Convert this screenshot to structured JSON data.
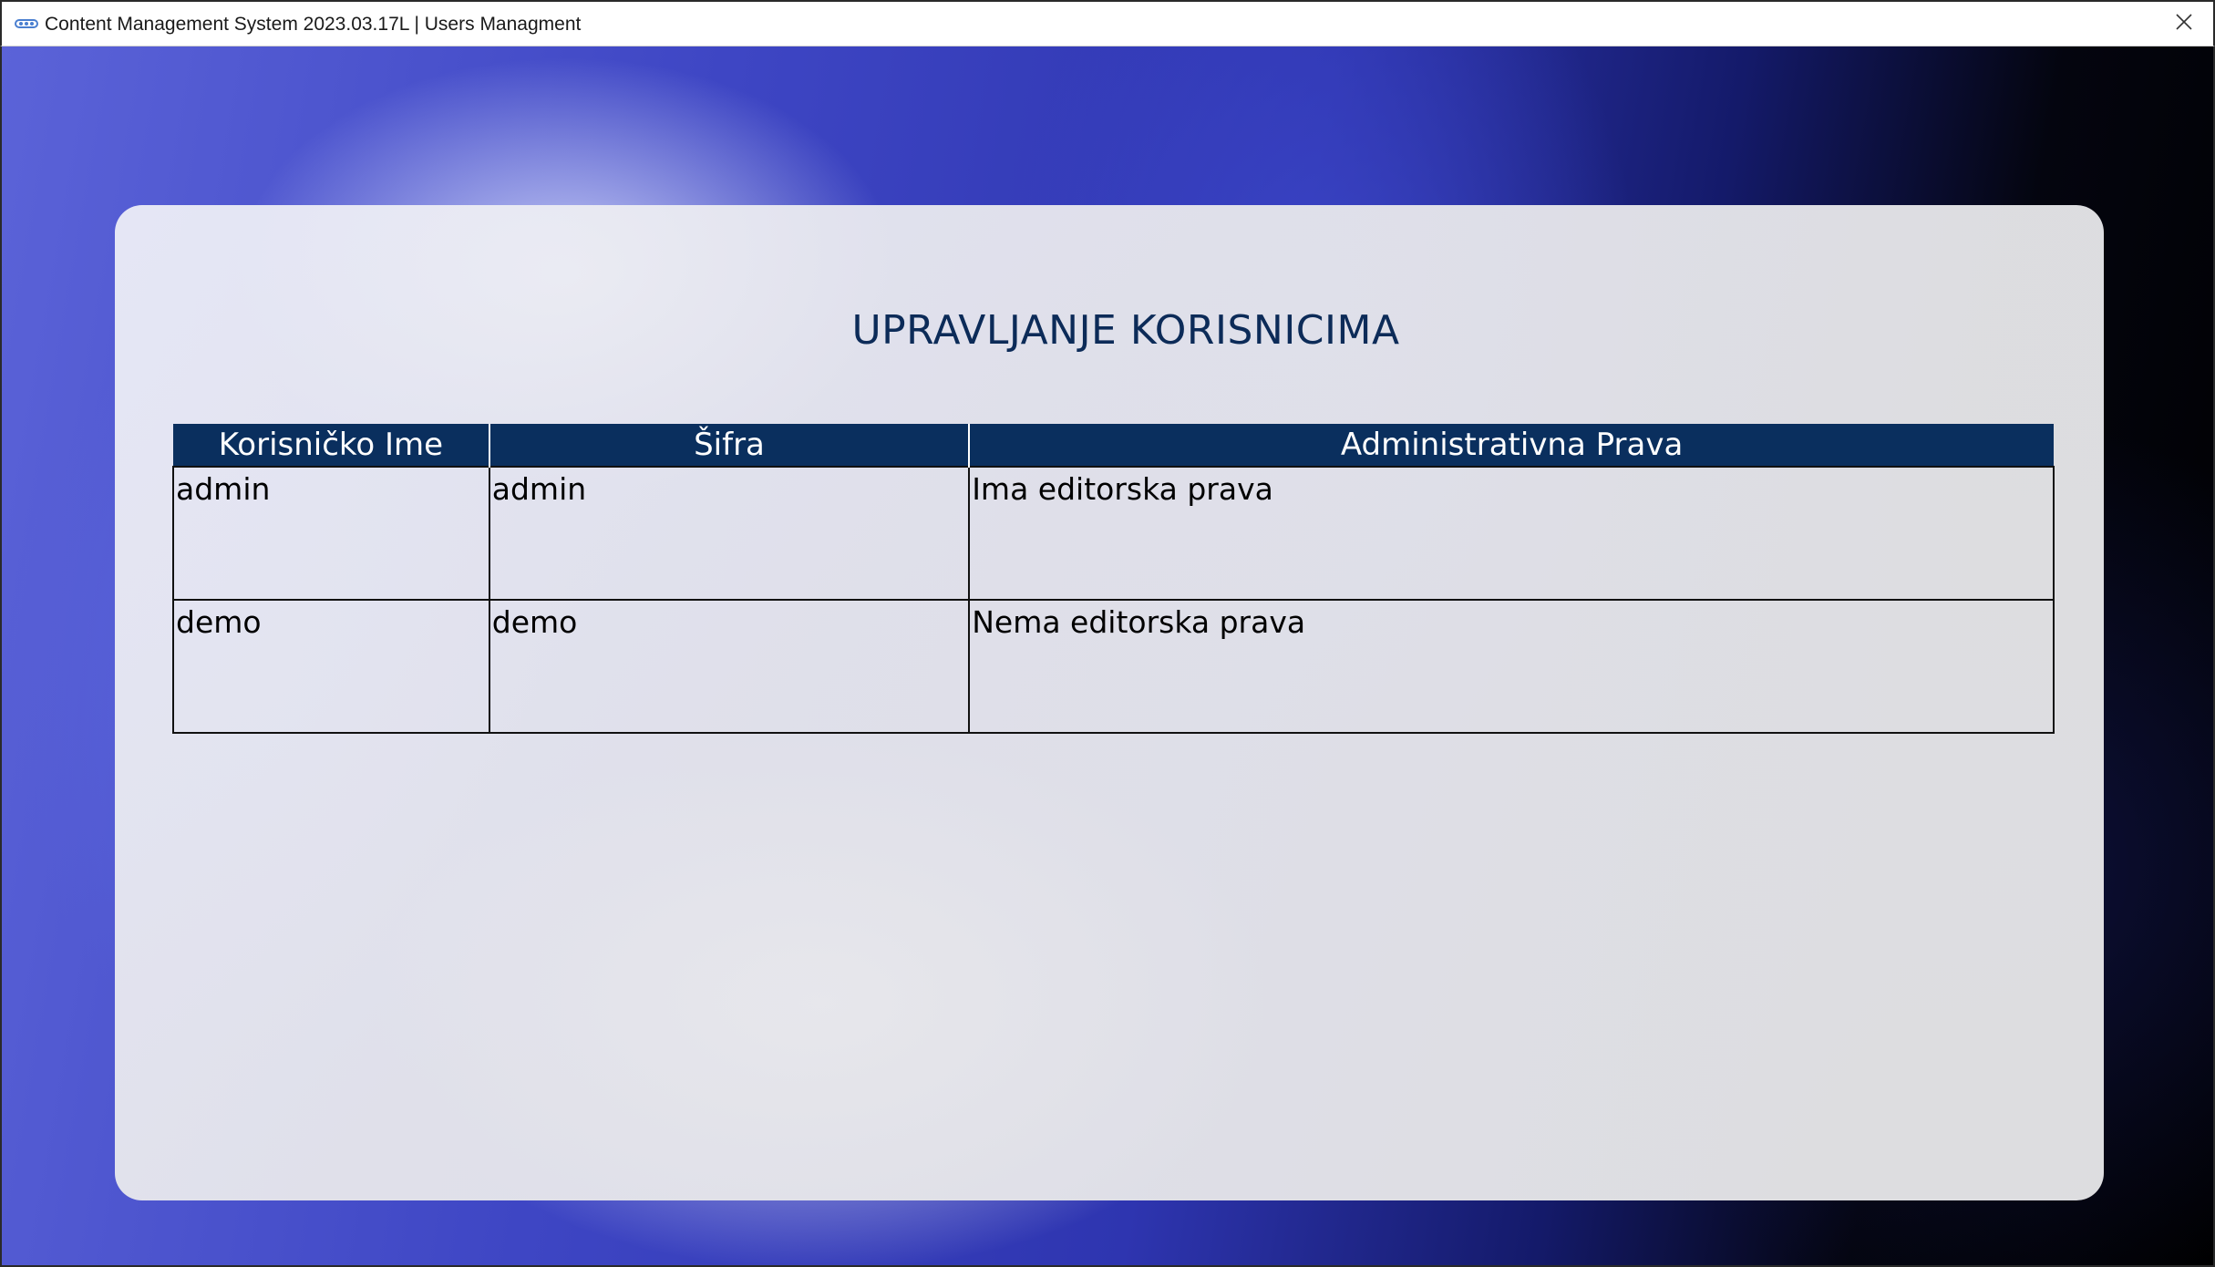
{
  "window": {
    "title": "Content Management System 2023.03.17L | Users Managment",
    "icon": "app-logo-icon",
    "close_icon": "close-icon"
  },
  "panel": {
    "title": "UPRAVLJANJE KORISNICIMA"
  },
  "table": {
    "headers": [
      "Korisničko Ime",
      "Šifra",
      "Administrativna Prava"
    ],
    "rows": [
      [
        "admin",
        "admin",
        "Ima editorska prava"
      ],
      [
        "demo",
        "demo",
        "Nema editorska prava"
      ]
    ]
  },
  "colors": {
    "header_bg": "#0a2f5e",
    "title_color": "#0c2b58"
  }
}
